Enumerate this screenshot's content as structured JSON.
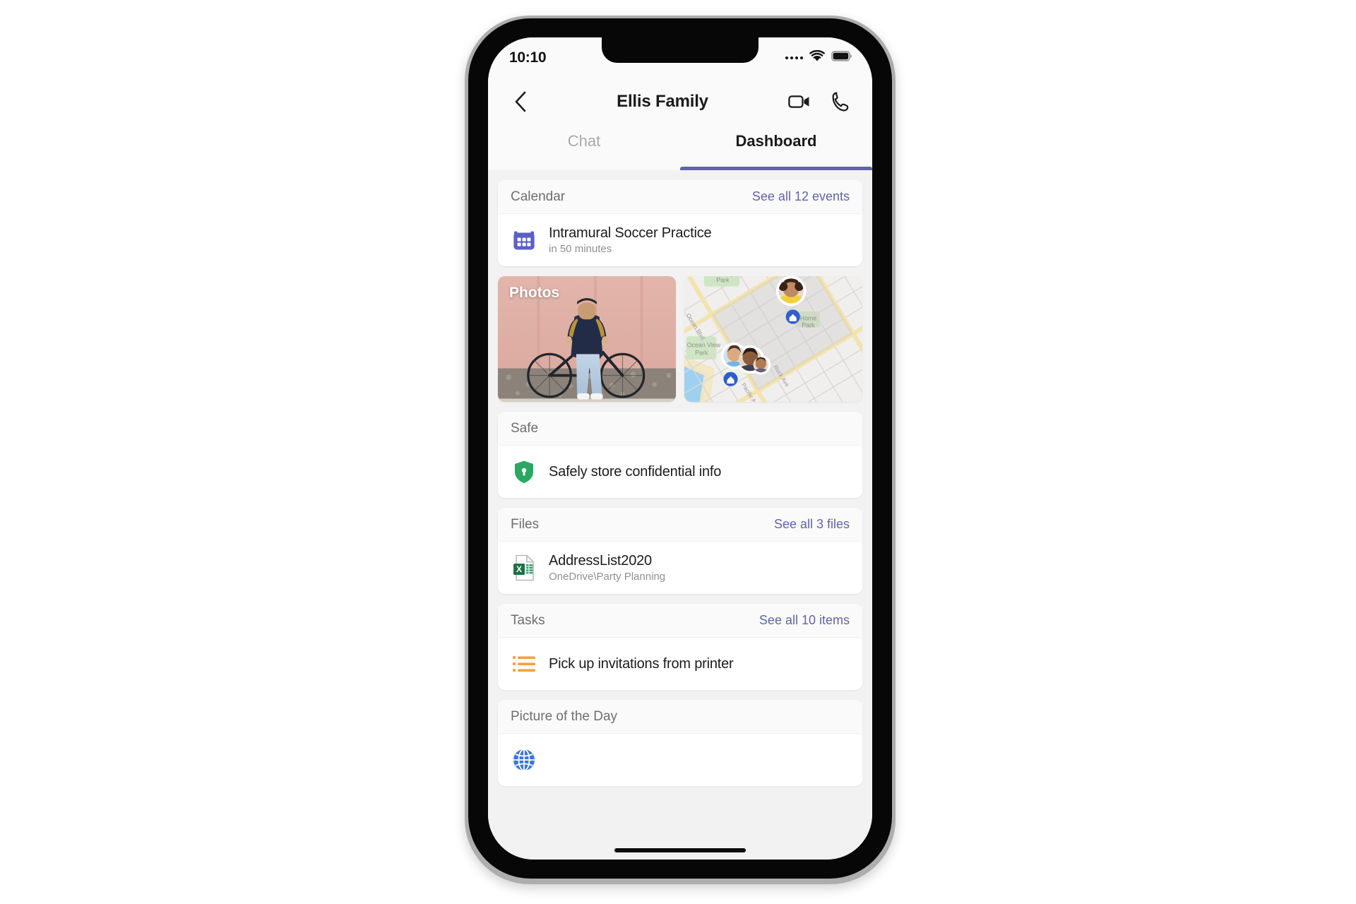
{
  "statusbar": {
    "time": "10:10",
    "signal_icon": "signal-dots-icon",
    "wifi_icon": "wifi-icon",
    "battery_icon": "battery-icon"
  },
  "navbar": {
    "back_icon": "chevron-left-icon",
    "title": "Ellis Family",
    "video_call_icon": "video-camera-icon",
    "audio_call_icon": "phone-icon"
  },
  "tabs": [
    {
      "label": "Chat",
      "active": false
    },
    {
      "label": "Dashboard",
      "active": true
    }
  ],
  "colors": {
    "accent_purple": "#6264A7",
    "link_purple": "#6264A7",
    "safe_green": "#2aa862",
    "excel_green": "#1e7145",
    "tasks_orange": "#f2a33c",
    "globe_blue": "#3a76d8",
    "screen_bg": "#f2f2f2"
  },
  "cards": {
    "calendar": {
      "title": "Calendar",
      "link": "See all 12 events",
      "icon": "calendar-icon",
      "item_title": "Intramural Soccer Practice",
      "item_sub": "in 50 minutes"
    },
    "photos_tile": {
      "label": "Photos",
      "image_alt": "person-with-bicycle-photo"
    },
    "map_tile": {
      "label": "Map",
      "park_label_1": "Los Amigos Park",
      "park_label_2": "Ocean View Park",
      "park_label_3": "Home Park",
      "street_label_1": "Rock Ave",
      "street_label_2": "Pacific Ave"
    },
    "safe": {
      "title": "Safe",
      "icon": "shield-lock-icon",
      "item_title": "Safely store confidential info"
    },
    "files": {
      "title": "Files",
      "link": "See all 3 files",
      "icon": "excel-file-icon",
      "item_title": "AddressList2020",
      "item_sub": "OneDrive\\Party Planning"
    },
    "tasks": {
      "title": "Tasks",
      "link": "See all 10 items",
      "icon": "task-list-icon",
      "item_title": "Pick up invitations from printer"
    },
    "picture_of_the_day": {
      "title": "Picture of the Day",
      "icon": "globe-icon"
    }
  }
}
